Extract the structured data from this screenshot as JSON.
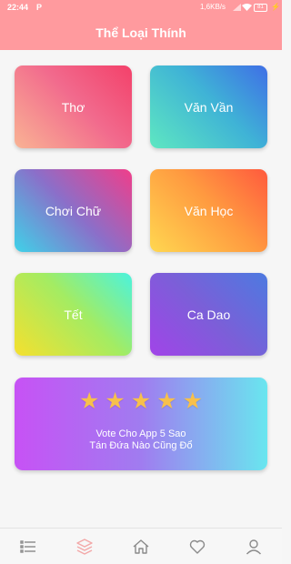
{
  "status_bar": {
    "time": "22:44",
    "carrier_icon": "P",
    "network_speed": "1,6KB/s",
    "battery": "81"
  },
  "app_bar": {
    "title": "Thể Loại Thính"
  },
  "categories": [
    {
      "label": "Thơ"
    },
    {
      "label": "Văn Vần"
    },
    {
      "label": "Chơi Chữ"
    },
    {
      "label": "Văn Học"
    },
    {
      "label": "Tết"
    },
    {
      "label": "Ca Dao"
    }
  ],
  "vote_card": {
    "stars": 5,
    "line1": "Vote Cho App 5 Sao",
    "line2": "Tán Đứa Nào Cũng Đổ",
    "star_color": "#f7c04b"
  },
  "bottom_nav": {
    "items": [
      {
        "icon": "list-icon"
      },
      {
        "icon": "layers-icon",
        "active": true
      },
      {
        "icon": "home-icon"
      },
      {
        "icon": "heart-icon"
      },
      {
        "icon": "user-icon"
      }
    ],
    "active_color": "#f3a8a8",
    "inactive_color": "#8a8a8a"
  },
  "colors": {
    "accent": "#ff9a9e"
  }
}
